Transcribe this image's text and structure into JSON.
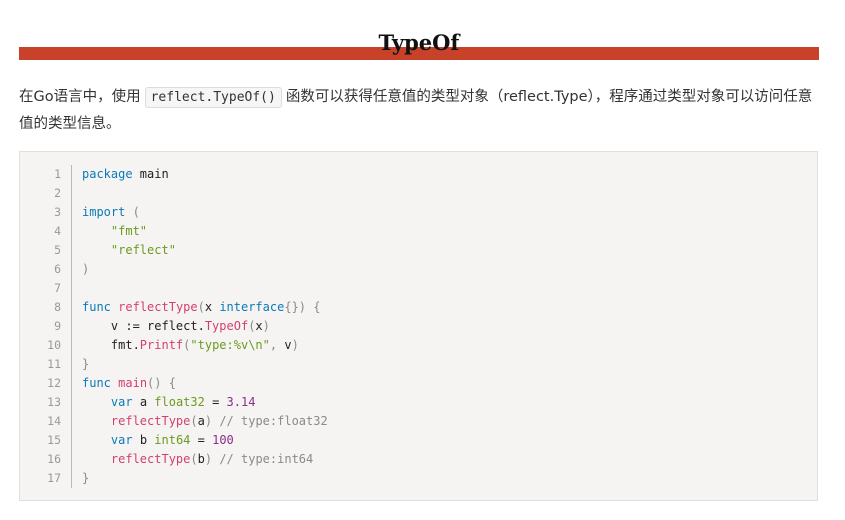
{
  "heading": "TypeOf",
  "intro": {
    "before": "在Go语言中，使用",
    "code": "reflect.TypeOf()",
    "after": "函数可以获得任意值的类型对象（reflect.Type），程序通过类型对象可以访问任意值的类型信息。"
  },
  "code_lines": [
    [
      [
        "kw",
        "package"
      ],
      [
        "t",
        " main"
      ]
    ],
    [],
    [
      [
        "kw",
        "import"
      ],
      [
        "pn",
        " ("
      ]
    ],
    [
      [
        "t",
        "    "
      ],
      [
        "str",
        "\"fmt\""
      ]
    ],
    [
      [
        "t",
        "    "
      ],
      [
        "str",
        "\"reflect\""
      ]
    ],
    [
      [
        "pn",
        ")"
      ]
    ],
    [],
    [
      [
        "kw",
        "func"
      ],
      [
        "t",
        " "
      ],
      [
        "fn",
        "reflectType"
      ],
      [
        "pn",
        "("
      ],
      [
        "t",
        "x "
      ],
      [
        "kw",
        "interface"
      ],
      [
        "pn",
        "{})"
      ],
      [
        "t",
        " "
      ],
      [
        "pn",
        "{"
      ]
    ],
    [
      [
        "t",
        "    v := reflect."
      ],
      [
        "fn",
        "TypeOf"
      ],
      [
        "pn",
        "("
      ],
      [
        "t",
        "x"
      ],
      [
        "pn",
        ")"
      ]
    ],
    [
      [
        "t",
        "    fmt."
      ],
      [
        "fn",
        "Printf"
      ],
      [
        "pn",
        "("
      ],
      [
        "str",
        "\"type:%v\\n\""
      ],
      [
        "pn",
        ","
      ],
      [
        "t",
        " v"
      ],
      [
        "pn",
        ")"
      ]
    ],
    [
      [
        "pn",
        "}"
      ]
    ],
    [
      [
        "kw",
        "func"
      ],
      [
        "t",
        " "
      ],
      [
        "fn",
        "main"
      ],
      [
        "pn",
        "()"
      ],
      [
        "t",
        " "
      ],
      [
        "pn",
        "{"
      ]
    ],
    [
      [
        "t",
        "    "
      ],
      [
        "kw",
        "var"
      ],
      [
        "t",
        " a "
      ],
      [
        "ty",
        "float32"
      ],
      [
        "t",
        " = "
      ],
      [
        "num",
        "3.14"
      ]
    ],
    [
      [
        "t",
        "    "
      ],
      [
        "fn",
        "reflectType"
      ],
      [
        "pn",
        "("
      ],
      [
        "t",
        "a"
      ],
      [
        "pn",
        ")"
      ],
      [
        "cm",
        " // type:float32"
      ]
    ],
    [
      [
        "t",
        "    "
      ],
      [
        "kw",
        "var"
      ],
      [
        "t",
        " b "
      ],
      [
        "ty",
        "int64"
      ],
      [
        "t",
        " = "
      ],
      [
        "num",
        "100"
      ]
    ],
    [
      [
        "t",
        "    "
      ],
      [
        "fn",
        "reflectType"
      ],
      [
        "pn",
        "("
      ],
      [
        "t",
        "b"
      ],
      [
        "pn",
        ")"
      ],
      [
        "cm",
        " // type:int64"
      ]
    ],
    [
      [
        "pn",
        "}"
      ]
    ]
  ]
}
